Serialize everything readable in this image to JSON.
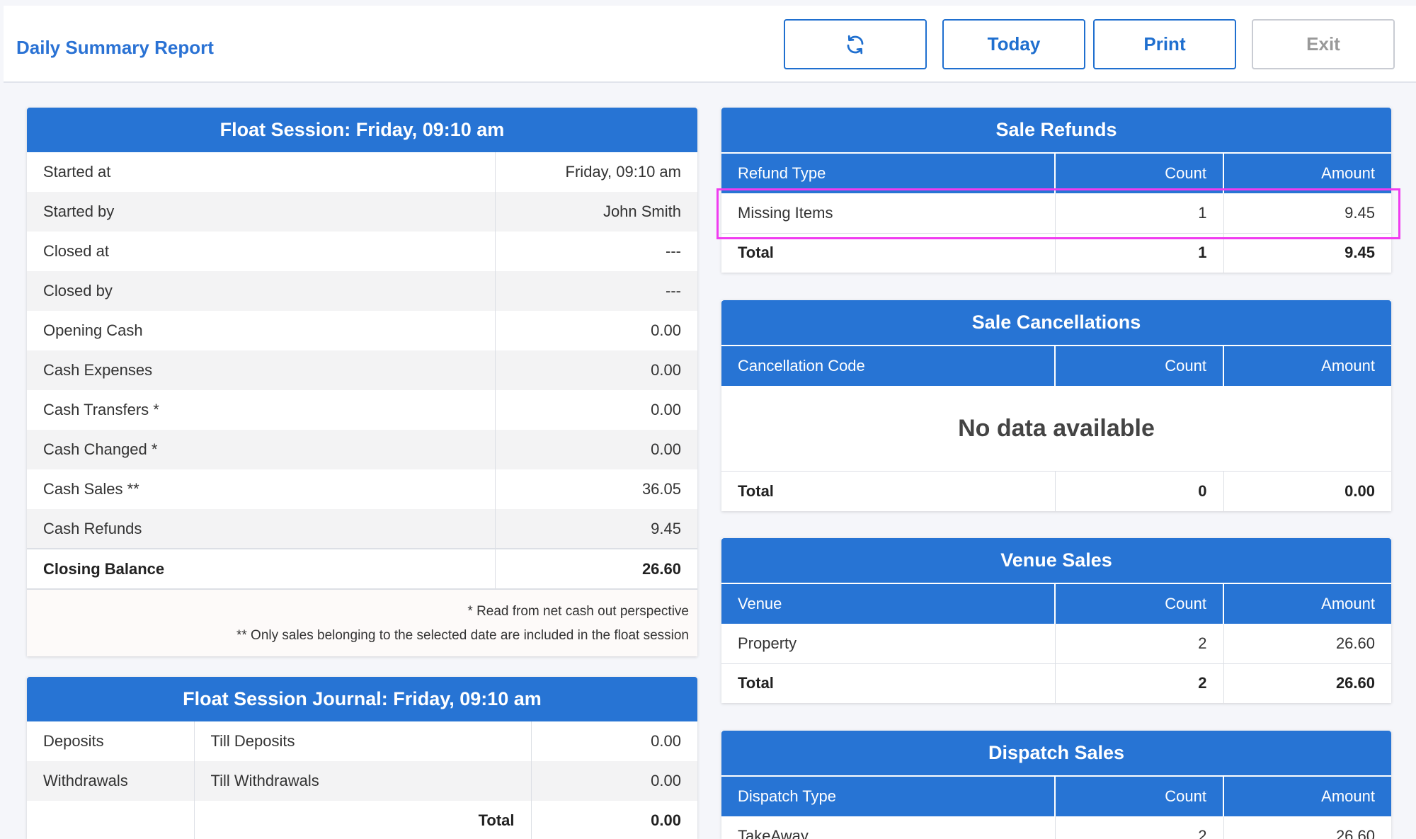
{
  "header": {
    "title": "Daily Summary Report",
    "refresh_icon": "refresh-icon",
    "today_label": "Today",
    "print_label": "Print",
    "exit_label": "Exit"
  },
  "float_session": {
    "title": "Float Session: Friday, 09:10 am",
    "rows": [
      {
        "label": "Started at",
        "value": "Friday, 09:10 am"
      },
      {
        "label": "Started by",
        "value": "John Smith"
      },
      {
        "label": "Closed at",
        "value": "---"
      },
      {
        "label": "Closed by",
        "value": "---"
      },
      {
        "label": "Opening Cash",
        "value": "0.00"
      },
      {
        "label": "Cash Expenses",
        "value": "0.00"
      },
      {
        "label": "Cash Transfers *",
        "value": "0.00"
      },
      {
        "label": "Cash Changed *",
        "value": "0.00"
      },
      {
        "label": "Cash Sales **",
        "value": "36.05"
      },
      {
        "label": "Cash Refunds",
        "value": "9.45"
      }
    ],
    "closing": {
      "label": "Closing Balance",
      "value": "26.60"
    },
    "notes": [
      "* Read from net cash out perspective",
      "** Only sales belonging to the selected date are included in the float session"
    ]
  },
  "journal": {
    "title": "Float Session Journal: Friday, 09:10 am",
    "rows": [
      {
        "type": "Deposits",
        "desc": "Till Deposits",
        "value": "0.00"
      },
      {
        "type": "Withdrawals",
        "desc": "Till Withdrawals",
        "value": "0.00"
      }
    ],
    "total_label": "Total",
    "total_value": "0.00"
  },
  "refunds": {
    "title": "Sale Refunds",
    "columns": [
      "Refund Type",
      "Count",
      "Amount"
    ],
    "rows": [
      {
        "type": "Missing Items",
        "count": "1",
        "amount": "9.45"
      }
    ],
    "total": {
      "label": "Total",
      "count": "1",
      "amount": "9.45"
    }
  },
  "cancellations": {
    "title": "Sale Cancellations",
    "columns": [
      "Cancellation Code",
      "Count",
      "Amount"
    ],
    "empty_text": "No data available",
    "total": {
      "label": "Total",
      "count": "0",
      "amount": "0.00"
    }
  },
  "venue_sales": {
    "title": "Venue Sales",
    "columns": [
      "Venue",
      "Count",
      "Amount"
    ],
    "rows": [
      {
        "venue": "Property",
        "count": "2",
        "amount": "26.60"
      }
    ],
    "total": {
      "label": "Total",
      "count": "2",
      "amount": "26.60"
    }
  },
  "dispatch_sales": {
    "title": "Dispatch Sales",
    "columns": [
      "Dispatch Type",
      "Count",
      "Amount"
    ],
    "rows": [
      {
        "type": "TakeAway",
        "count": "2",
        "amount": "26.60"
      }
    ]
  },
  "colors": {
    "accent": "#2774d4",
    "title_blue": "#2a72d4",
    "highlight": "#f03cf0"
  }
}
